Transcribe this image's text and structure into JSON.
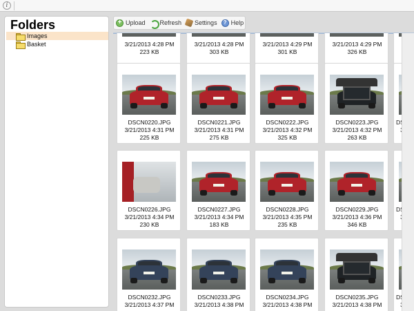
{
  "folders_panel": {
    "title": "Folders",
    "items": [
      {
        "label": "Images",
        "selected": true
      },
      {
        "label": "Basket",
        "selected": false
      }
    ]
  },
  "toolbar": {
    "upload_label": "Upload",
    "refresh_label": "Refresh",
    "settings_label": "Settings",
    "help_label": "Help"
  },
  "thumbnails": [
    {
      "name": "",
      "date": "3/21/2013 4:28 PM",
      "size": "223 KB",
      "style": "red"
    },
    {
      "name": "",
      "date": "3/21/2013 4:28 PM",
      "size": "303 KB",
      "style": "red"
    },
    {
      "name": "",
      "date": "3/21/2013 4:29 PM",
      "size": "301 KB",
      "style": "red"
    },
    {
      "name": "",
      "date": "3/21/2013 4:29 PM",
      "size": "326 KB",
      "style": "red"
    },
    {
      "name": "DSCN0220.JPG",
      "date": "3/21/2013 4:31 PM",
      "size": "225 KB",
      "style": "red"
    },
    {
      "name": "DSCN0221.JPG",
      "date": "3/21/2013 4:31 PM",
      "size": "275 KB",
      "style": "red"
    },
    {
      "name": "DSCN0222.JPG",
      "date": "3/21/2013 4:32 PM",
      "size": "325 KB",
      "style": "red"
    },
    {
      "name": "DSCN0223.JPG",
      "date": "3/21/2013 4:32 PM",
      "size": "263 KB",
      "style": "trunk"
    },
    {
      "name": "DSCN0226.JPG",
      "date": "3/21/2013 4:34 PM",
      "size": "230 KB",
      "style": "interior"
    },
    {
      "name": "DSCN0227.JPG",
      "date": "3/21/2013 4:34 PM",
      "size": "183 KB",
      "style": "red"
    },
    {
      "name": "DSCN0228.JPG",
      "date": "3/21/2013 4:35 PM",
      "size": "235 KB",
      "style": "red"
    },
    {
      "name": "DSCN0229.JPG",
      "date": "3/21/2013 4:36 PM",
      "size": "346 KB",
      "style": "red"
    },
    {
      "name": "DSCN0232.JPG",
      "date": "3/21/2013 4:37 PM",
      "size": "",
      "style": "blue"
    },
    {
      "name": "DSCN0233.JPG",
      "date": "3/21/2013 4:38 PM",
      "size": "",
      "style": "blue"
    },
    {
      "name": "DSCN0234.JPG",
      "date": "3/21/2013 4:38 PM",
      "size": "",
      "style": "blue"
    },
    {
      "name": "DSCN0235.JPG",
      "date": "3/21/2013 4:38 PM",
      "size": "",
      "style": "trunk"
    }
  ],
  "partial_column": [
    {
      "name": "",
      "date": "",
      "size": ""
    },
    {
      "name": "DSC",
      "date": "3/2",
      "size": ""
    },
    {
      "name": "DSC",
      "date": "3/2",
      "size": ""
    },
    {
      "name": "DSC",
      "date": "3/2",
      "size": ""
    }
  ]
}
